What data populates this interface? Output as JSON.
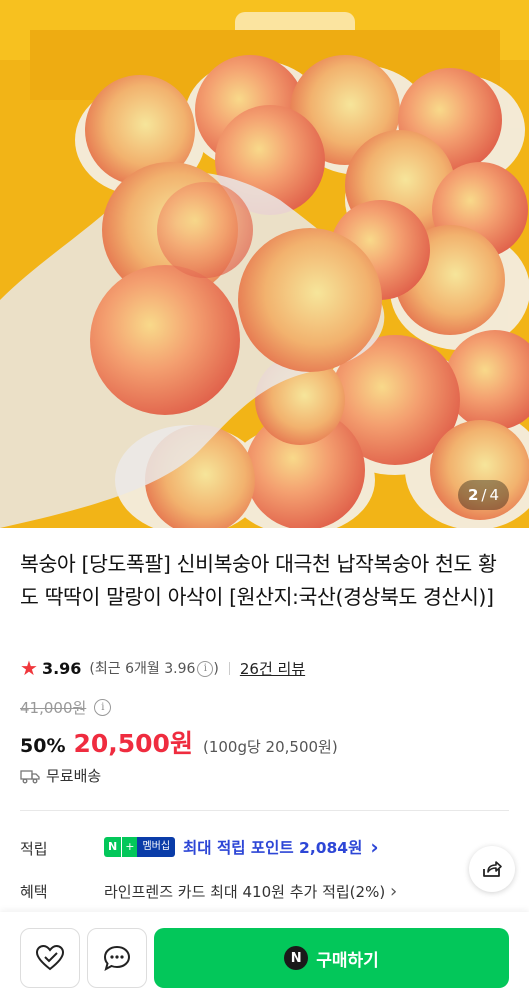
{
  "product": {
    "title": "복숭아 [당도폭팔] 신비복숭아 대극천 납작복숭아 천도 황도 딱딱이 말랑이 아삭이 [원산지:국산(경상북도 경산시)]",
    "image_counter": {
      "current": "2",
      "separator": "/",
      "total": "4"
    }
  },
  "rating": {
    "score": "3.96",
    "recent": "(최근 6개월 3.96",
    "recent_close": ")",
    "review_link": "26건 리뷰"
  },
  "price": {
    "original": "41,000원",
    "discount": "50%",
    "sale": "20,500원",
    "unit": "(100g당 20,500원)"
  },
  "delivery": {
    "label": "무료배송"
  },
  "points": {
    "label": "적립",
    "badge_n": "N",
    "badge_plus": "+",
    "badge_member": "멤버십",
    "text": "최대 적립 포인트 2,084원",
    "chevron": "›"
  },
  "benefit": {
    "label": "혜택",
    "text": "라인프렌즈 카드 최대 410원 추가 적립(2%)",
    "chevron": "›"
  },
  "bottom": {
    "buy_label": "구매하기",
    "buy_icon": "N"
  },
  "colors": {
    "accent_green": "#03c75a",
    "price_red": "#ef2c3f",
    "points_blue": "#2d46d6",
    "star": "#f0373c"
  },
  "icons": [
    "star-icon",
    "info-icon",
    "truck-icon",
    "share-icon",
    "heart-icon",
    "chat-icon",
    "naver-n-icon"
  ]
}
